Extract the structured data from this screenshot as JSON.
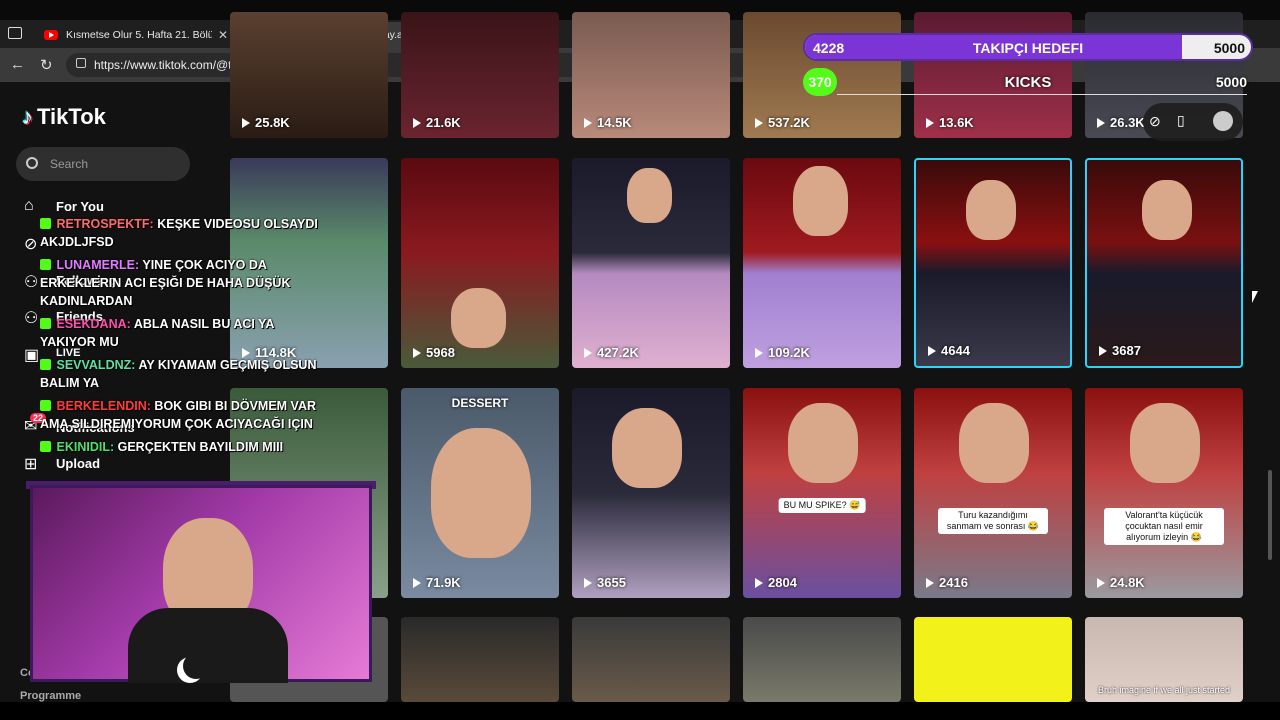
{
  "browser": {
    "tabs": [
      {
        "title": "Kısmetse Olur 5. Hafta 21. Bölüm",
        "icon": "youtube-icon"
      },
      {
        "title": "(23)Tugay Akdeniz (@tugay.akdeniz",
        "icon": "tiktok-icon"
      }
    ],
    "url": "https://www.tiktok.com/@tugay.akdeniz"
  },
  "tiktok": {
    "logo": "TikTok",
    "search_placeholder": "Search",
    "nav": [
      "For You",
      "Following",
      "Friends",
      "LIVE",
      "Notifications",
      "Upload"
    ],
    "notification_count": "22",
    "footer": [
      "Company",
      "Programme"
    ]
  },
  "overlay": {
    "goal": {
      "current": "4228",
      "label": "TAKIPÇI HEDEFI",
      "max": "5000",
      "progress": 0.8456
    },
    "kicks": {
      "current": "370",
      "label": "KICKS",
      "max": "5000"
    },
    "chat": [
      {
        "user": "RETROSPEKTF:",
        "color": "#ff6b6b",
        "text": "KEŞKE VIDEOSU OLSAYDI AKJDLJFSD"
      },
      {
        "user": "LUNAMERLE:",
        "color": "#e07cff",
        "text": "YINE ÇOK ACIYO DA ERKEKLERIN ACI EŞIĞI DE HAHA DÜŞÜK KADINLARDAN"
      },
      {
        "user": "ESEKDANA:",
        "color": "#ff4fb0",
        "text": "ABLA NASIL BU ACI YA YAKIYOR MU"
      },
      {
        "user": "SEVVALDNZ:",
        "color": "#5ee0a0",
        "text": "AY KIYAMAM GEÇMIŞ OLSUN BALIM YA"
      },
      {
        "user": "BERKELENDIN:",
        "color": "#ff3b3b",
        "text": "BOK GIBI BI DÖVMEM VAR AMA SILDIREMIYORUM ÇOK ACIYACAĞI IÇIN"
      },
      {
        "user": "EKINIDIL:",
        "color": "#4ee06a",
        "text": "GERÇEKTEN BAYILDIM MIII"
      }
    ]
  },
  "videos": {
    "row1": [
      "25.8K",
      "21.6K",
      "14.5K",
      "537.2K",
      "13.6K",
      "26.3K"
    ],
    "row2": [
      "114.8K",
      "5968",
      "427.2K",
      "109.2K",
      "4644",
      "3687"
    ],
    "row3": [
      "71.9K",
      "3655",
      "2804",
      "2416",
      "24.8K"
    ],
    "captions": {
      "dessert": "DESSERT",
      "spike": "BU MU SPIKE? 😅",
      "turu": "Turu kazandığımı sanmam ve sonrası 😂",
      "valorant": "Valorant'ta küçücük çocuktan nasıl emir alıyorum izleyin 😂",
      "bruh": "Bruh imagine if we all just started"
    }
  },
  "colors": {
    "goal_fill": "#7b35d6",
    "kick_green": "#53fc18",
    "tiktok_cyan": "#25f4ee",
    "tiktok_red": "#fe2c55"
  }
}
